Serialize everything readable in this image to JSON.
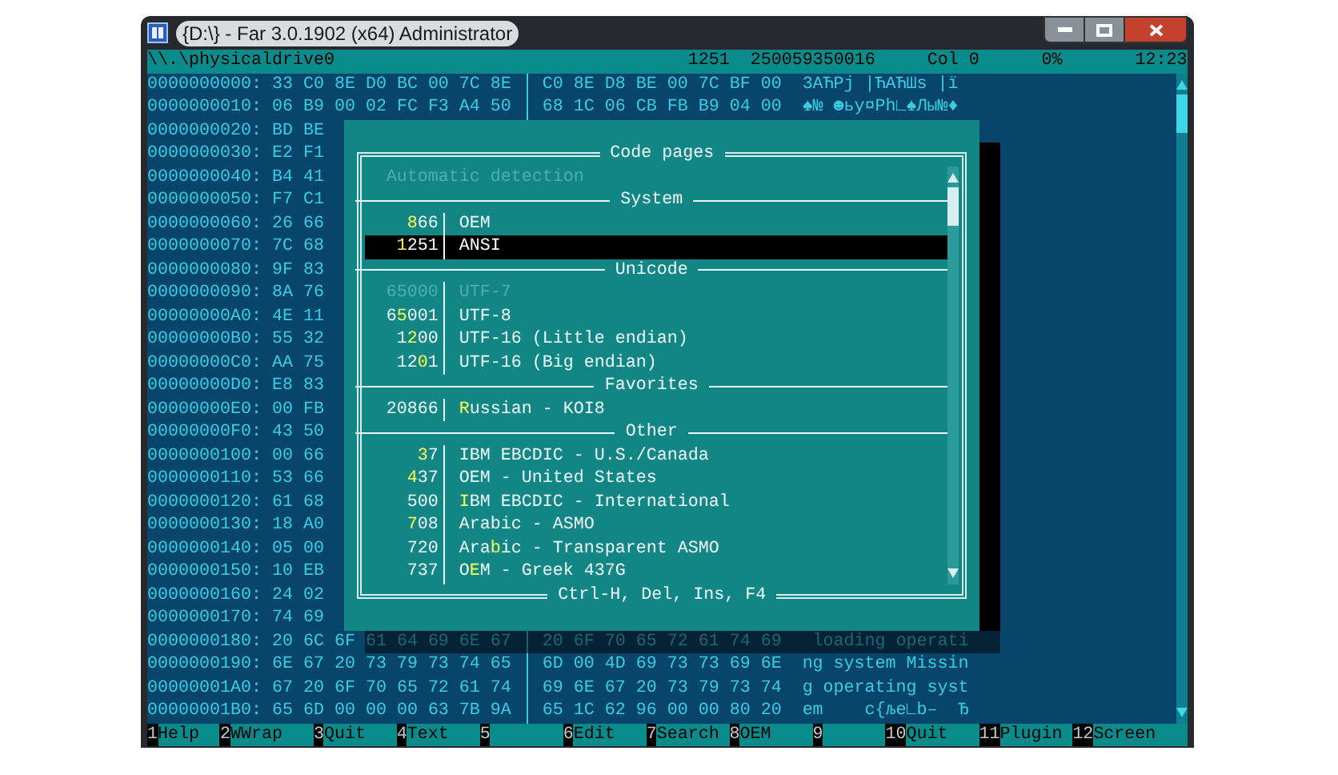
{
  "window": {
    "title": "{D:\\} - Far 3.0.1902 (x64) Administrator"
  },
  "header": {
    "path": "\\\\.\\physicaldrive0",
    "codepage": "1251",
    "size": "250059350016",
    "column": "Col 0",
    "percent": "0%",
    "clock": "12:23"
  },
  "hex_rows": [
    {
      "offset": "0000000000:",
      "bytes_1": "33 C0 8E D0 BC 00 7C 8E",
      "bytes_2": "C0 8E D8 BE 00 7C BF 00",
      "text": "3АЋРј |ЋАЋШѕ |ї"
    },
    {
      "offset": "0000000010:",
      "bytes_1": "06 B9 00 02 FC F3 A4 50",
      "bytes_2": "68 1C 06 CB FB B9 04 00",
      "text": "♠№ ☻ьу¤Ph∟♠Лы№♦"
    },
    {
      "offset": "0000000020:",
      "bytes_1": "BD BE"
    },
    {
      "offset": "0000000030:",
      "bytes_1": "E2 F1"
    },
    {
      "offset": "0000000040:",
      "bytes_1": "B4 41"
    },
    {
      "offset": "0000000050:",
      "bytes_1": "F7 C1"
    },
    {
      "offset": "0000000060:",
      "bytes_1": "26 66"
    },
    {
      "offset": "0000000070:",
      "bytes_1": "7C 68"
    },
    {
      "offset": "0000000080:",
      "bytes_1": "9F 83"
    },
    {
      "offset": "0000000090:",
      "bytes_1": "8A 76"
    },
    {
      "offset": "00000000A0:",
      "bytes_1": "4E 11"
    },
    {
      "offset": "00000000B0:",
      "bytes_1": "55 32"
    },
    {
      "offset": "00000000C0:",
      "bytes_1": "AA 75"
    },
    {
      "offset": "00000000D0:",
      "bytes_1": "E8 83"
    },
    {
      "offset": "00000000E0:",
      "bytes_1": "00 FB"
    },
    {
      "offset": "00000000F0:",
      "bytes_1": "43 50"
    },
    {
      "offset": "0000000100:",
      "bytes_1": "00 66"
    },
    {
      "offset": "0000000110:",
      "bytes_1": "53 66"
    },
    {
      "offset": "0000000120:",
      "bytes_1": "61 68"
    },
    {
      "offset": "0000000130:",
      "bytes_1": "18 A0"
    },
    {
      "offset": "0000000140:",
      "bytes_1": "05 00"
    },
    {
      "offset": "0000000150:",
      "bytes_1": "10 EB"
    },
    {
      "offset": "0000000160:",
      "bytes_1": "24 02"
    },
    {
      "offset": "0000000170:",
      "bytes_1": "74 69"
    },
    {
      "offset": "0000000180:",
      "bytes_1": "20 6C 6F 61 64 69 6E 67",
      "bytes_2": "20 6F 70 65 72 61 74 69",
      "text": " loading operati"
    },
    {
      "offset": "0000000190:",
      "bytes_1": "6E 67 20 73 79 73 74 65",
      "bytes_2": "6D 00 4D 69 73 73 69 6E",
      "text": "ng system Missin"
    },
    {
      "offset": "00000001A0:",
      "bytes_1": "67 20 6F 70 65 72 61 74",
      "bytes_2": "69 6E 67 20 73 79 73 74",
      "text": "g operating syst"
    },
    {
      "offset": "00000001B0:",
      "bytes_1": "65 6D 00 00 00 63 7B 9A",
      "bytes_2": "65 1C 62 96 00 00 80 20",
      "text": "em    c{љe∟b–  Ђ"
    }
  ],
  "dialog": {
    "title": "Code pages",
    "footer": "Ctrl-H, Del, Ins, F4",
    "items": [
      {
        "kind": "plain",
        "name": "Automatic detection",
        "disabled": true,
        "selected": false
      },
      {
        "kind": "separator",
        "label": "System"
      },
      {
        "kind": "item",
        "number": "**8**66",
        "name": "OEM",
        "disabled": false,
        "selected": false
      },
      {
        "kind": "item",
        "number": "**1**251",
        "name": "ANSI",
        "disabled": false,
        "selected": true
      },
      {
        "kind": "separator",
        "label": "Unicode"
      },
      {
        "kind": "item",
        "number": "65000",
        "name": "UTF-7",
        "disabled": true,
        "selected": false
      },
      {
        "kind": "item",
        "number": "6**5**001",
        "name": "UTF-8",
        "disabled": false,
        "selected": false
      },
      {
        "kind": "item",
        "number": "1**2**00",
        "name": "UTF-16 (Little endian)",
        "disabled": false,
        "selected": false
      },
      {
        "kind": "item",
        "number": "12**0**1",
        "name": "UTF-16 (Big endian)",
        "disabled": false,
        "selected": false
      },
      {
        "kind": "separator",
        "label": "Favorites"
      },
      {
        "kind": "item",
        "number": "20866",
        "name": "**R**ussian - KOI8",
        "disabled": false,
        "selected": false
      },
      {
        "kind": "separator",
        "label": "Other"
      },
      {
        "kind": "item",
        "number": "**3**7",
        "name": "IBM EBCDIC - U.S./Canada",
        "disabled": false,
        "selected": false
      },
      {
        "kind": "item",
        "number": "**4**37",
        "name": "OEM - United States",
        "disabled": false,
        "selected": false
      },
      {
        "kind": "item",
        "number": "500",
        "name": "**I**BM EBCDIC - International",
        "disabled": false,
        "selected": false
      },
      {
        "kind": "item",
        "number": "**7**08",
        "name": "Arabic - ASMO",
        "disabled": false,
        "selected": false
      },
      {
        "kind": "item",
        "number": "720",
        "name": "Ara**b**ic - Transparent ASMO",
        "disabled": false,
        "selected": false
      },
      {
        "kind": "item",
        "number": "737",
        "name": "O**E**M - Greek 437G",
        "disabled": false,
        "selected": false
      }
    ]
  },
  "keybar": [
    {
      "key": "1",
      "label": "Help"
    },
    {
      "key": "2",
      "label": "WWrap"
    },
    {
      "key": "3",
      "label": "Quit"
    },
    {
      "key": "4",
      "label": "Text"
    },
    {
      "key": "5"
    },
    {
      "key": "6",
      "label": "Edit"
    },
    {
      "key": "7",
      "label": "Search"
    },
    {
      "key": "8",
      "label": "OEM"
    },
    {
      "key": "9"
    },
    {
      "key": "10",
      "label": "Quit"
    },
    {
      "key": "11",
      "label": "Plugin"
    },
    {
      "key": "12",
      "label": "Screen"
    }
  ]
}
